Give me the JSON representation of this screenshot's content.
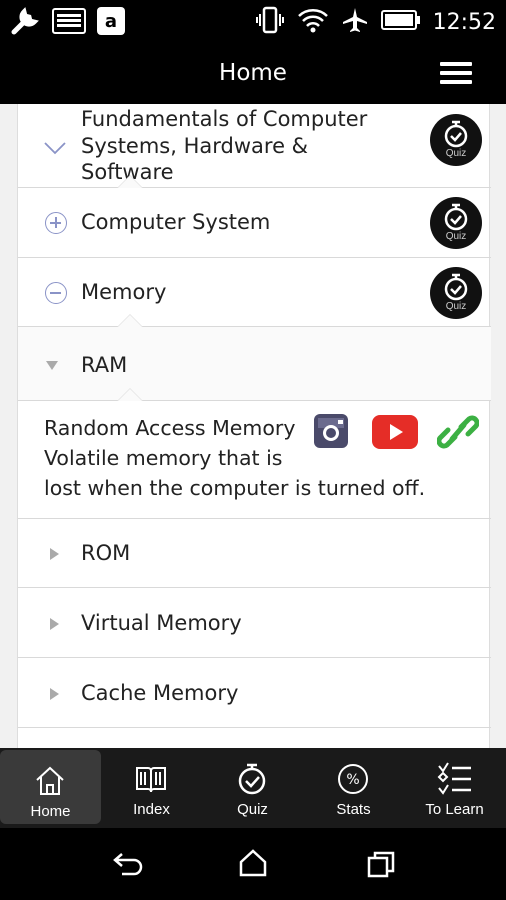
{
  "status_bar": {
    "time": "12:52",
    "left_icons": [
      "wrench-icon",
      "keyboard-icon",
      "amazon-icon"
    ],
    "right_icons": [
      "vibrate-icon",
      "wifi-icon",
      "airplane-icon",
      "battery-icon"
    ]
  },
  "app_bar": {
    "title": "Home",
    "menu_icon": "hamburger-icon"
  },
  "topics": [
    {
      "label_lines": [
        "Fundamentals of Computer",
        "Systems, Hardware &",
        "Software"
      ],
      "state": "expanded",
      "quiz": "Quiz"
    },
    {
      "label": "Computer System",
      "state": "collapsed",
      "quiz": "Quiz"
    },
    {
      "label": "Memory",
      "state": "expanded",
      "quiz": "Quiz"
    }
  ],
  "subtopics": [
    {
      "label": "RAM",
      "state": "expanded"
    },
    {
      "label": "ROM",
      "state": "collapsed"
    },
    {
      "label": "Virtual Memory",
      "state": "collapsed"
    },
    {
      "label": "Cache Memory",
      "state": "collapsed"
    }
  ],
  "ram_detail": {
    "lines": [
      "Random Access Memory",
      "Volatile memory that is",
      "lost when the computer is turned off."
    ],
    "links": [
      "instagram-icon",
      "youtube-icon",
      "link-icon"
    ],
    "colors": {
      "instagram": "#4a4a6a",
      "youtube": "#e52d27",
      "link": "#3cb043"
    }
  },
  "bottom_nav": [
    {
      "label": "Home",
      "icon": "home-icon",
      "active": true
    },
    {
      "label": "Index",
      "icon": "book-icon",
      "active": false
    },
    {
      "label": "Quiz",
      "icon": "stopwatch-icon",
      "active": false
    },
    {
      "label": "Stats",
      "icon": "percent-icon",
      "active": false
    },
    {
      "label": "To Learn",
      "icon": "checklist-icon",
      "active": false
    }
  ],
  "system_nav": [
    "back-icon",
    "home-system-icon",
    "recents-icon"
  ]
}
